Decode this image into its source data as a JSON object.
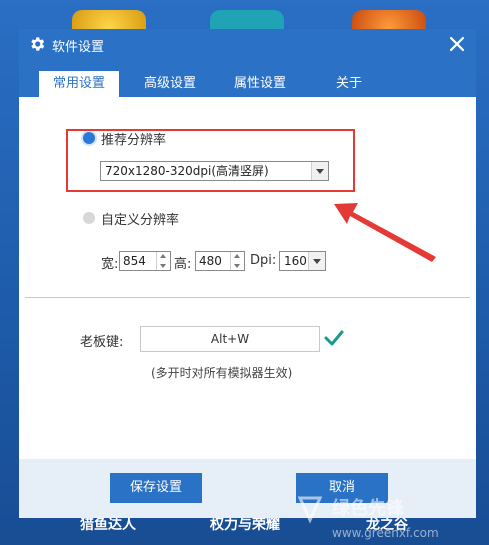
{
  "window": {
    "title": "软件设置"
  },
  "tabs": [
    {
      "label": "常用设置",
      "active": true
    },
    {
      "label": "高级设置",
      "active": false
    },
    {
      "label": "属性设置",
      "active": false
    },
    {
      "label": "关于",
      "active": false
    }
  ],
  "resolution": {
    "recommended_label": "推荐分辨率",
    "recommended_selected": true,
    "recommended_value": "720x1280-320dpi(高清竖屏)",
    "custom_label": "自定义分辨率",
    "custom_selected": false,
    "width_label": "宽:",
    "width_value": "854",
    "height_label": "高:",
    "height_value": "480",
    "dpi_label": "Dpi:",
    "dpi_value": "160"
  },
  "boss_key": {
    "label": "老板键:",
    "value": "Alt+W",
    "note": "(多开时对所有模拟器生效)"
  },
  "buttons": {
    "save": "保存设置",
    "cancel": "取消"
  },
  "background_apps": [
    "猎鱼达人",
    "权力与荣耀",
    "龙之谷"
  ],
  "watermark": {
    "brand": "绿色先锋",
    "url": "www.greenxf.com"
  },
  "colors": {
    "accent": "#2b72c7",
    "highlight": "#e53935",
    "check": "#1a9a8a"
  },
  "icons": [
    "gear-icon",
    "close-icon",
    "chevron-down-icon",
    "checkmark-icon",
    "arrow-annotation"
  ]
}
